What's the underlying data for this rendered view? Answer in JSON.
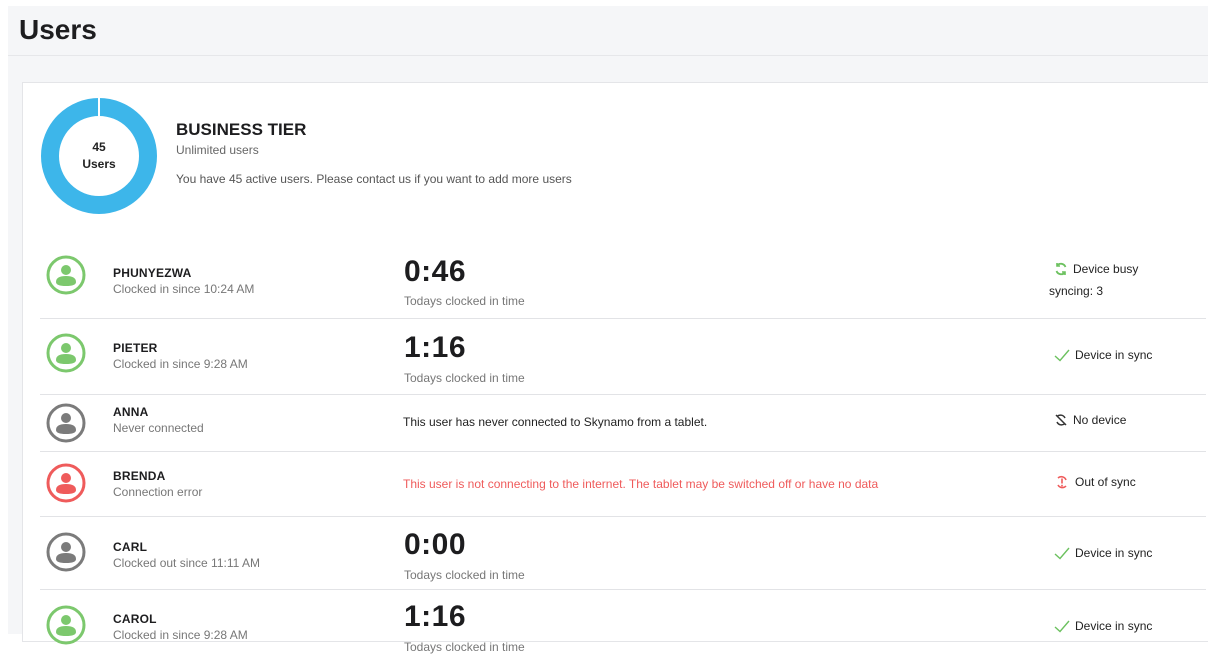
{
  "page": {
    "title": "Users"
  },
  "tier": {
    "count": "45",
    "count_label": "Users",
    "name": "BUSINESS TIER",
    "limit": "Unlimited users",
    "info": "You have 45 active users. Please contact us if you want to add more users",
    "ring_color": "#3db6ea"
  },
  "colors": {
    "active": "#7cc86d",
    "inactive": "#7b7b7b",
    "error": "#ef5b5b",
    "sync_ok": "#6cc15f"
  },
  "users": [
    {
      "name": "PHUNYEZWA",
      "status": "Clocked in since 10:24 AM",
      "time": "0:46",
      "time_label": "Todays clocked in time",
      "sync_icon": "refresh-icon",
      "sync_label": "Device busy",
      "sync_count": "syncing: 3"
    },
    {
      "name": "PIETER",
      "status": "Clocked in since 9:28 AM",
      "time": "1:16",
      "time_label": "Todays clocked in time",
      "sync_icon": "check-icon",
      "sync_label": "Device in sync"
    },
    {
      "name": "ANNA",
      "status": "Never connected",
      "message": "This user has never connected to Skynamo from a tablet.",
      "sync_icon": "no-sync-icon",
      "sync_label": "No device"
    },
    {
      "name": "BRENDA",
      "status": "Connection error",
      "message": "This user is not connecting to the internet. The tablet may be switched off or have no data",
      "sync_icon": "out-of-sync-icon",
      "sync_label": "Out of sync"
    },
    {
      "name": "CARL",
      "status": "Clocked out since 11:11 AM",
      "time": "0:00",
      "time_label": "Todays clocked in time",
      "sync_icon": "check-icon",
      "sync_label": "Device in sync"
    },
    {
      "name": "CAROL",
      "status": "Clocked in since 9:28 AM",
      "time": "1:16",
      "time_label": "Todays clocked in time",
      "sync_icon": "check-icon",
      "sync_label": "Device in sync"
    }
  ]
}
